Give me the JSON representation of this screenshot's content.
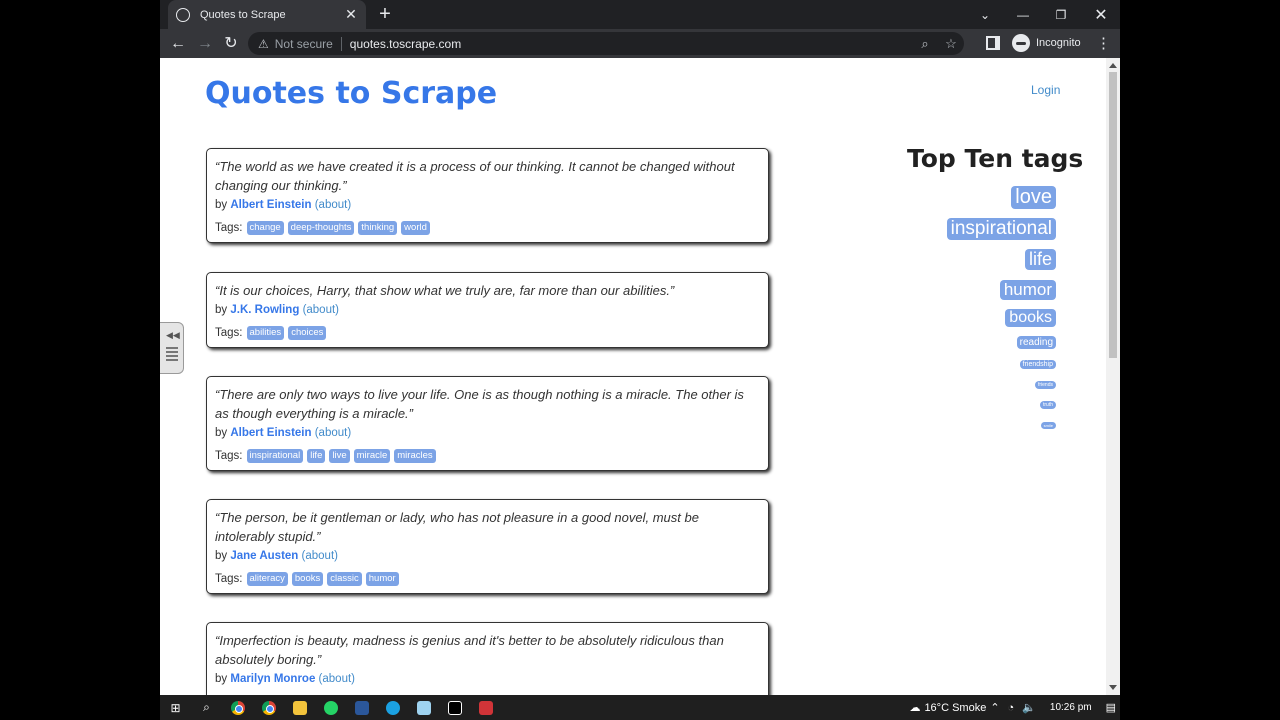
{
  "browser": {
    "tab_title": "Quotes to Scrape",
    "new_tab_symbol": "+",
    "security_label": "Not secure",
    "url": "quotes.toscrape.com",
    "profile_label": "Incognito"
  },
  "page": {
    "site_title": "Quotes to Scrape",
    "login_label": "Login",
    "by_label": "by",
    "about_label": "(about)",
    "tags_label": "Tags:",
    "quotes": [
      {
        "text": "“The world as we have created it is a process of our thinking. It cannot be changed without changing our thinking.”",
        "author": "Albert Einstein",
        "tags": [
          "change",
          "deep-thoughts",
          "thinking",
          "world"
        ]
      },
      {
        "text": "“It is our choices, Harry, that show what we truly are, far more than our abilities.”",
        "author": "J.K. Rowling",
        "tags": [
          "abilities",
          "choices"
        ]
      },
      {
        "text": "“There are only two ways to live your life. One is as though nothing is a miracle. The other is as though everything is a miracle.”",
        "author": "Albert Einstein",
        "tags": [
          "inspirational",
          "life",
          "live",
          "miracle",
          "miracles"
        ]
      },
      {
        "text": "“The person, be it gentleman or lady, who has not pleasure in a good novel, must be intolerably stupid.”",
        "author": "Jane Austen",
        "tags": [
          "aliteracy",
          "books",
          "classic",
          "humor"
        ]
      },
      {
        "text": "“Imperfection is beauty, madness is genius and it's better to be absolutely ridiculous than absolutely boring.”",
        "author": "Marilyn Monroe",
        "tags": []
      }
    ],
    "top_tags_title": "Top Ten tags",
    "top_tags": [
      "love",
      "inspirational",
      "life",
      "humor",
      "books",
      "reading",
      "friendship",
      "friends",
      "truth",
      "smile"
    ]
  },
  "taskbar": {
    "weather": "16°C  Smoke",
    "time": "10:26 pm"
  },
  "colors": {
    "accent": "#3677e8",
    "tag": "#7ca3e6",
    "chrome_dark": "#202124",
    "chrome_toolbar": "#35363a"
  }
}
